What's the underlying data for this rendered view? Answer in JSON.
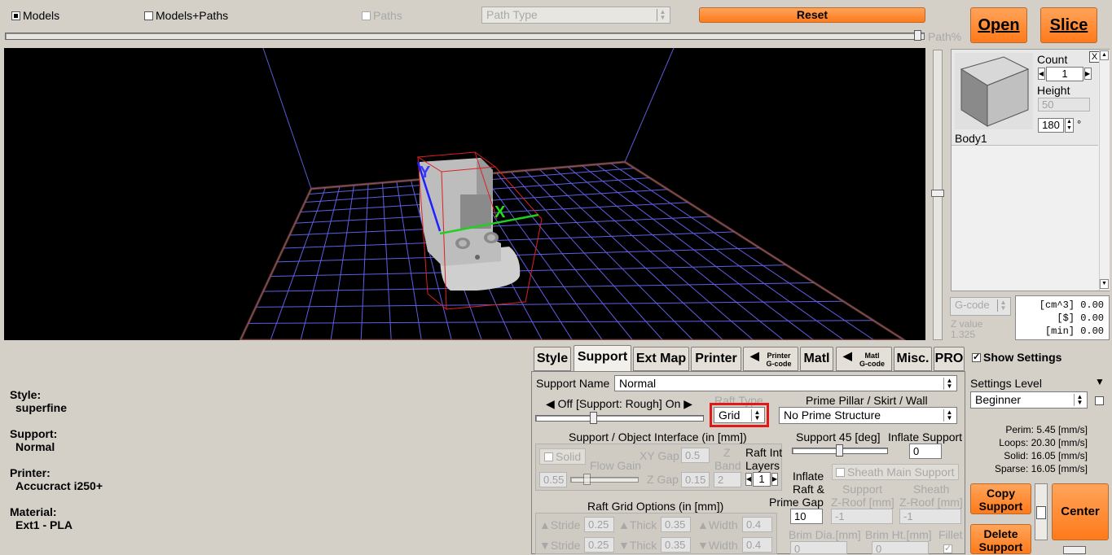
{
  "top": {
    "models": "Models",
    "models_paths": "Models+Paths",
    "paths": "Paths",
    "path_type": "Path Type",
    "reset": "Reset",
    "path_pct": "Path%",
    "open": "Open",
    "slice": "Slice"
  },
  "viewport": {
    "axis_y": "Y",
    "axis_x": "X"
  },
  "model_panel": {
    "count_label": "Count",
    "count": "1",
    "height_label": "Height",
    "height": "50",
    "angle": "180",
    "degree": "°",
    "body_name": "Body1",
    "close": "X"
  },
  "gcode": {
    "dropdown": "G-code",
    "z_label": "Z value",
    "z_value": "1.325",
    "volume": "[cm^3] 0.00",
    "cost": "[$] 0.00",
    "time": "[min] 0.00"
  },
  "tabs": {
    "style": "Style",
    "support": "Support",
    "ext_map": "Ext Map",
    "printer": "Printer",
    "printer_gcode_1": "Printer",
    "printer_gcode_2": "G-code",
    "matl": "Matl",
    "matl_gcode_1": "Matl",
    "matl_gcode_2": "G-code",
    "misc": "Misc.",
    "pro": "PRO"
  },
  "summary": {
    "style_label": "Style:",
    "style_value": "superfine",
    "support_label": "Support:",
    "support_value": "Normal",
    "printer_label": "Printer:",
    "printer_value": "Accucract i250+",
    "material_label": "Material:",
    "material_value": "Ext1 - PLA"
  },
  "support": {
    "name_label": "Support Name",
    "name_value": "Normal",
    "slider_label": "Off [Support: Rough] On",
    "raft_type_label": "Raft Type",
    "raft_type_value": "Grid",
    "prime_label": "Prime Pillar / Skirt /  Wall",
    "prime_value": "No Prime Structure",
    "interface_title": "Support / Object Interface (in [mm])",
    "solid": "Solid",
    "xy_gap": "XY Gap",
    "xy_gap_value": "0.5",
    "z_band_1": "Z",
    "z_band_2": "Band",
    "z_band_value": "2",
    "flow_gain": "Flow Gain",
    "flow_gain_value": "0.55",
    "z_gap": "Z Gap",
    "z_gap_value": "0.15",
    "raft_int_1": "Raft Int",
    "raft_int_2": "Layers",
    "raft_int_value": "1",
    "support45": "Support 45 [deg]",
    "inflate_support": "Inflate Support",
    "inflate_support_value": "0",
    "inflate_raft_1": "Inflate",
    "inflate_raft_2": "Raft &",
    "inflate_raft_3": "Prime Gap",
    "inflate_raft_value": "10",
    "sheath_main": "Sheath Main Support",
    "support_roof_1": "Support",
    "support_roof_2": "Z-Roof [mm]",
    "support_roof_value": "-1",
    "sheath_roof_1": "Sheath",
    "sheath_roof_2": "Z-Roof [mm]",
    "sheath_roof_value": "-1",
    "raft_grid_title": "Raft Grid Options (in [mm])",
    "stride": "Stride",
    "stride_value": "0.25",
    "thick": "Thick",
    "thick_value": "0.35",
    "width": "Width",
    "width_value": "0.4",
    "brim_dia": "Brim Dia.[mm]",
    "brim_dia_value": "0",
    "brim_ht": "Brim Ht.[mm]",
    "brim_ht_value": "0",
    "fillet": "Fillet"
  },
  "right": {
    "show_settings": "Show Settings",
    "settings_level_label": "Settings Level",
    "settings_level": "Beginner",
    "perim": "Perim:  5.45 [mm/s]",
    "loops": "Loops: 20.30 [mm/s]",
    "solid": "Solid:  16.05 [mm/s]",
    "sparse": "Sparse: 16.05 [mm/s]",
    "copy_support_1": "Copy",
    "copy_support_2": "Support",
    "delete_support_1": "Delete",
    "delete_support_2": "Support",
    "center": "Center"
  },
  "colors": {
    "accent": "#ff8a2a",
    "grid": "#6a6aff",
    "bbox": "#e02020"
  }
}
